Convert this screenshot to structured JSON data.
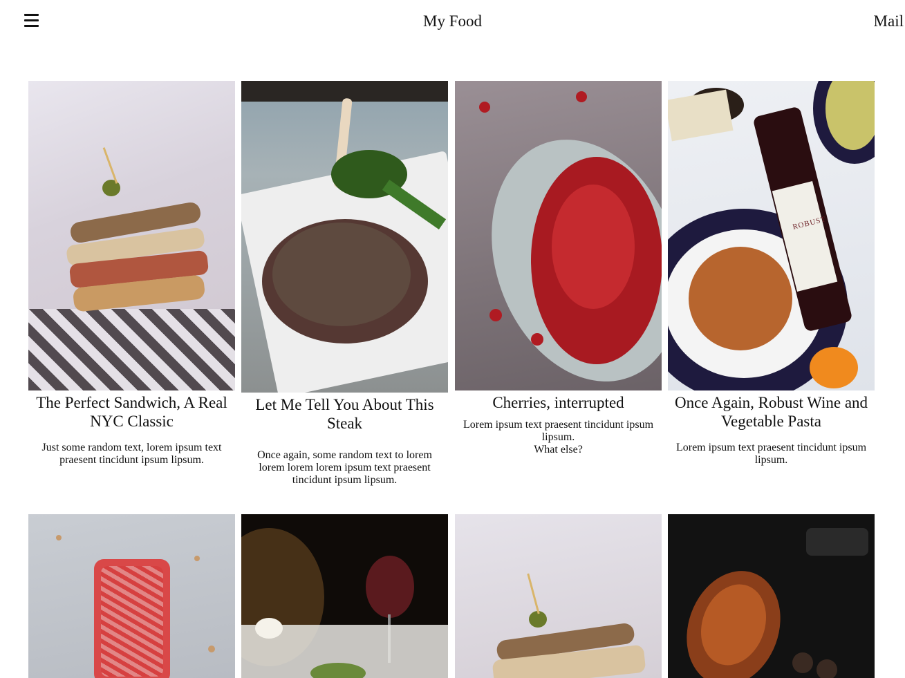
{
  "header": {
    "menu_icon": "hamburger-menu-icon",
    "title": "My Food",
    "mail_label": "Mail"
  },
  "cards": [
    {
      "title": "The Perfect Sandwich, A Real NYC Classic",
      "text": "Just some random text, lorem ipsum text praesent tincidunt ipsum lipsum.",
      "image": "sandwich-photo"
    },
    {
      "title": "Let Me Tell You About This Steak",
      "text": "Once again, some random text to lorem lorem lorem lorem ipsum text praesent tincidunt ipsum lipsum.",
      "image": "steak-photo"
    },
    {
      "title": "Cherries, interrupted",
      "text": "Lorem ipsum text praesent tincidunt ipsum lipsum.\nWhat else?",
      "image": "cherries-photo"
    },
    {
      "title": "Once Again, Robust Wine and Vegetable Pasta",
      "text": "Lorem ipsum text praesent tincidunt ipsum lipsum.",
      "image": "wine-pasta-photo",
      "wine_label": "ROBUST"
    },
    {
      "image": "popsicle-photo"
    },
    {
      "image": "wine-glasses-photo"
    },
    {
      "image": "sandwich-photo"
    },
    {
      "image": "croissant-photo"
    }
  ],
  "colors": {
    "text": "#111111",
    "background": "#ffffff"
  }
}
